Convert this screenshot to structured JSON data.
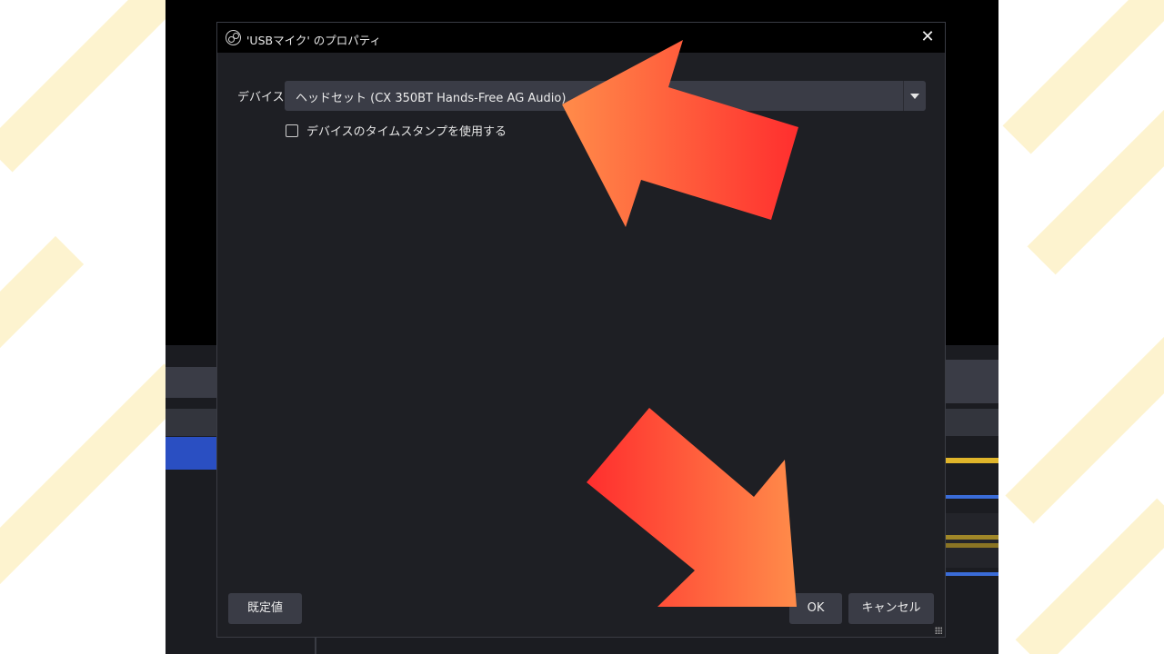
{
  "dialog": {
    "title": "'USBマイク' のプロパティ",
    "close_icon": "close-icon",
    "app_icon": "obs-logo-icon"
  },
  "device": {
    "label": "デバイス",
    "selected": "ヘッドセット (CX 350BT Hands-Free AG Audio)"
  },
  "timestamp_option": {
    "label": "デバイスのタイムスタンプを使用する",
    "checked": false
  },
  "buttons": {
    "defaults": "既定値",
    "ok": "OK",
    "cancel": "キャンセル"
  },
  "colors": {
    "dialog_bg": "#1e1f24",
    "titlebar_bg": "#000000",
    "control_bg": "#3a3c46",
    "arrow_light": "#ff8c4a",
    "arrow_dark": "#ff2e2e",
    "stripe": "#fdf3cf"
  }
}
